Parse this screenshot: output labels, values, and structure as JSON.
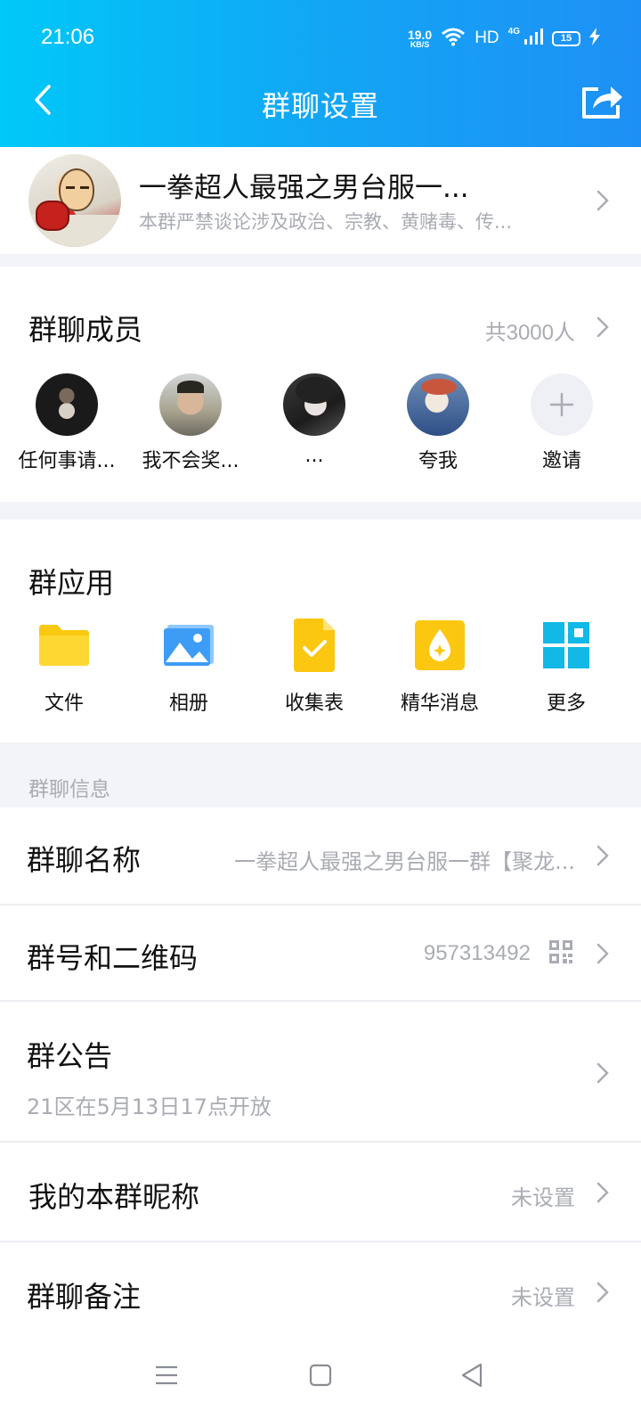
{
  "status": {
    "time": "21:06",
    "speed_value": "19.0",
    "speed_unit": "KB/S",
    "hd": "HD",
    "network": "4G",
    "battery": "15"
  },
  "header": {
    "title": "群聊设置",
    "back_icon": "chevron-left-icon",
    "share_icon": "share-icon"
  },
  "group": {
    "name": "一拳超人最强之男台服一...",
    "description": "本群严禁谈论涉及政治、宗教、黄赌毒、传..."
  },
  "members": {
    "title": "群聊成员",
    "count": "共3000人",
    "list": [
      {
        "name": "任何事请..."
      },
      {
        "name": "我不会奖..."
      },
      {
        "name": "..."
      },
      {
        "name": "夸我"
      },
      {
        "name": "邀请"
      }
    ]
  },
  "apps": {
    "title": "群应用",
    "items": [
      {
        "label": "文件",
        "icon": "folder-icon"
      },
      {
        "label": "相册",
        "icon": "photo-album-icon"
      },
      {
        "label": "收集表",
        "icon": "form-icon"
      },
      {
        "label": "精华消息",
        "icon": "essence-icon"
      },
      {
        "label": "更多",
        "icon": "more-grid-icon"
      }
    ]
  },
  "info": {
    "section_label": "群聊信息",
    "group_name_title": "群聊名称",
    "group_name_value": "一拳超人最强之男台服一群【聚龙...",
    "group_number_title": "群号和二维码",
    "group_number_value": "957313492",
    "notice_title": "群公告",
    "notice_value": "21区在5月13日17点开放",
    "nickname_title": "我的本群昵称",
    "nickname_value": "未设置",
    "remark_title": "群聊备注",
    "remark_value": "未设置"
  },
  "colors": {
    "header_start": "#00c8f8",
    "header_end": "#1e90f5",
    "secondary_text": "#a9acb3"
  }
}
